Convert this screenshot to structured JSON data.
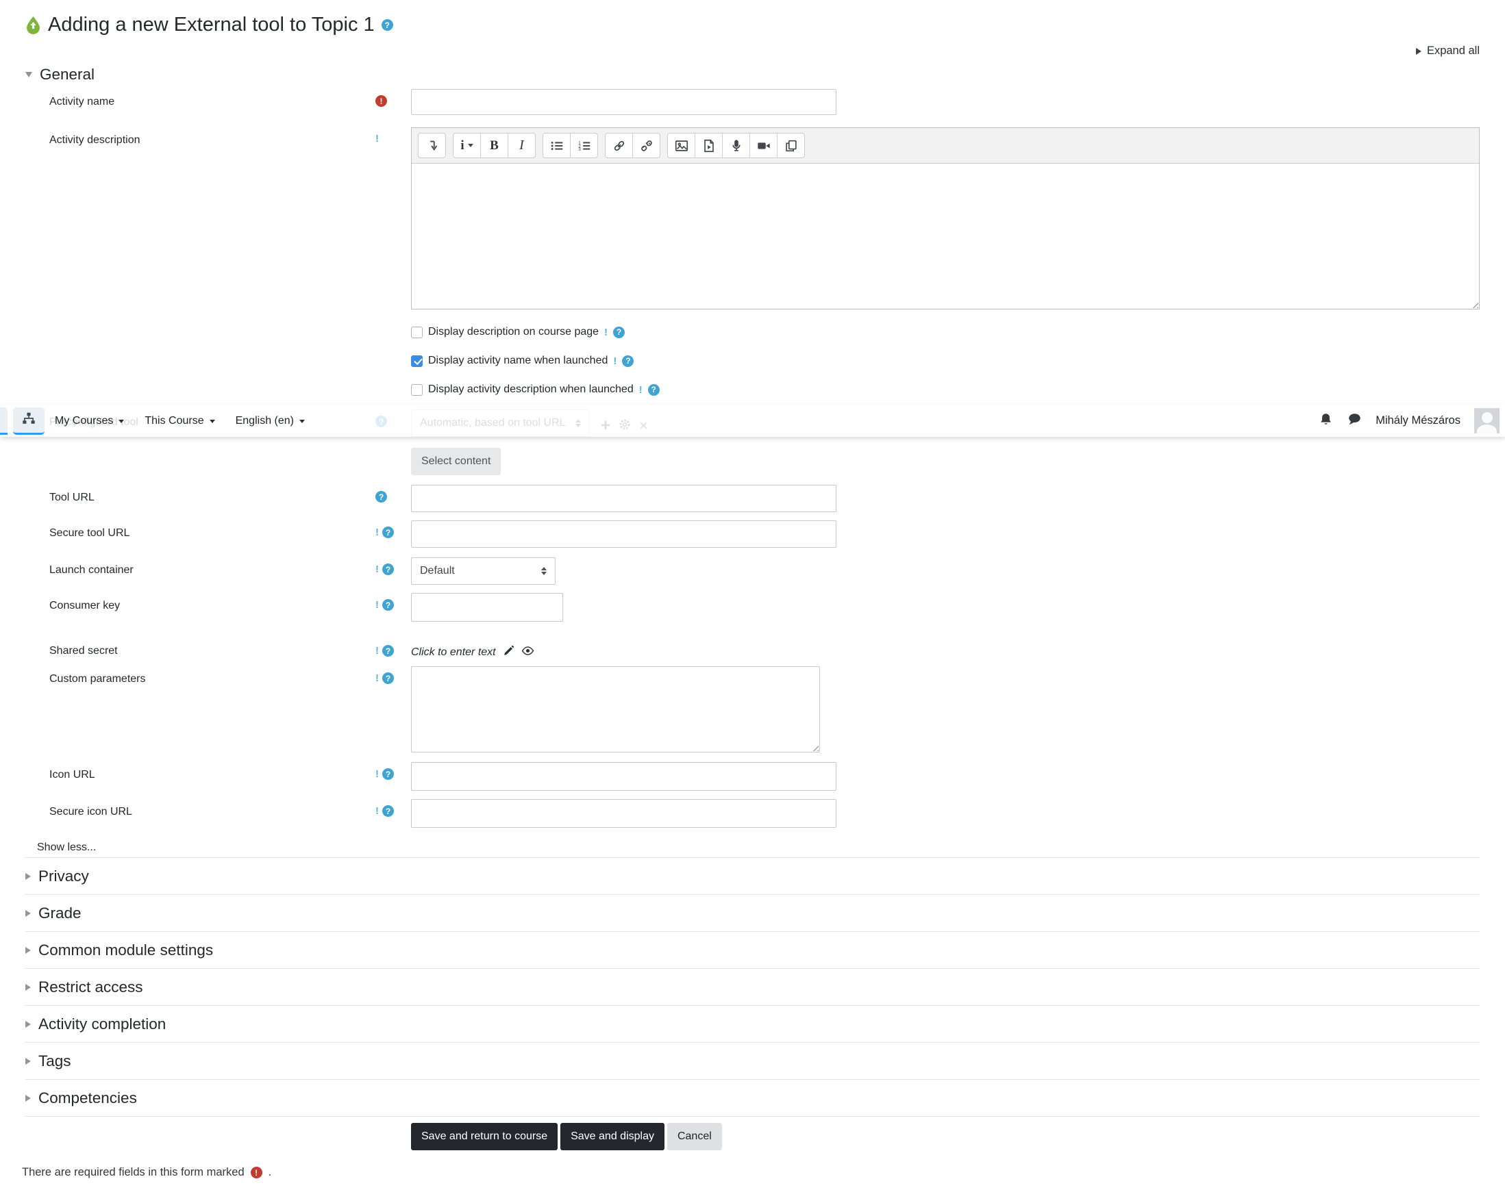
{
  "header": {
    "title": "Adding a new External tool to Topic 1",
    "expand_all_label": "Expand all"
  },
  "navbar": {
    "items": [
      {
        "label": "My Courses"
      },
      {
        "label": "This Course"
      },
      {
        "label": "English (en)"
      }
    ],
    "user_name": "Mihály Mészáros",
    "icons": [
      "sitemap-icon",
      "bell-icon",
      "chat-icon",
      "avatar"
    ]
  },
  "general_section": {
    "heading": "General",
    "activity_name_label": "Activity name",
    "activity_description_label": "Activity description",
    "editor_toolbar_icons": [
      "collapse-toolbar",
      "paragraph-styles",
      "bold",
      "italic",
      "unordered-list",
      "ordered-list",
      "link",
      "unlink",
      "insert-image",
      "insert-media",
      "record-audio",
      "record-video",
      "manage-files"
    ],
    "checkboxes": [
      {
        "label": "Display description on course page",
        "checked": false
      },
      {
        "label": "Display activity name when launched",
        "checked": true
      },
      {
        "label": "Display activity description when launched",
        "checked": false
      }
    ],
    "preconfigured_tool": {
      "label": "Preconfigured tool",
      "selected_option": "Automatic, based on tool URL"
    },
    "select_content_label": "Select content",
    "fields": {
      "tool_url": "Tool URL",
      "secure_tool_url": "Secure tool URL",
      "launch_container": {
        "label": "Launch container",
        "selected_option": "Default"
      },
      "consumer_key": "Consumer key",
      "shared_secret": {
        "label": "Shared secret",
        "placeholder_text": "Click to enter text"
      },
      "custom_parameters": "Custom parameters",
      "icon_url": "Icon URL",
      "secure_icon_url": "Secure icon URL"
    },
    "show_less_label": "Show less..."
  },
  "collapsed_sections": [
    {
      "label": "Privacy"
    },
    {
      "label": "Grade"
    },
    {
      "label": "Common module settings"
    },
    {
      "label": "Restrict access"
    },
    {
      "label": "Activity completion"
    },
    {
      "label": "Tags"
    },
    {
      "label": "Competencies"
    }
  ],
  "actions": {
    "save_return_label": "Save and return to course",
    "save_display_label": "Save and display",
    "cancel_label": "Cancel"
  },
  "footer": {
    "required_note": "There are required fields in this form marked",
    "required_note_suffix": "."
  },
  "colors": {
    "accent_blue": "#2b9cf2",
    "help_icon": "#3fa4d4",
    "required_icon": "#c23b2e",
    "checkbox_checked": "#3b8de4",
    "primary_button": "#24282e",
    "tool_icon_green": "#7eb63a"
  }
}
